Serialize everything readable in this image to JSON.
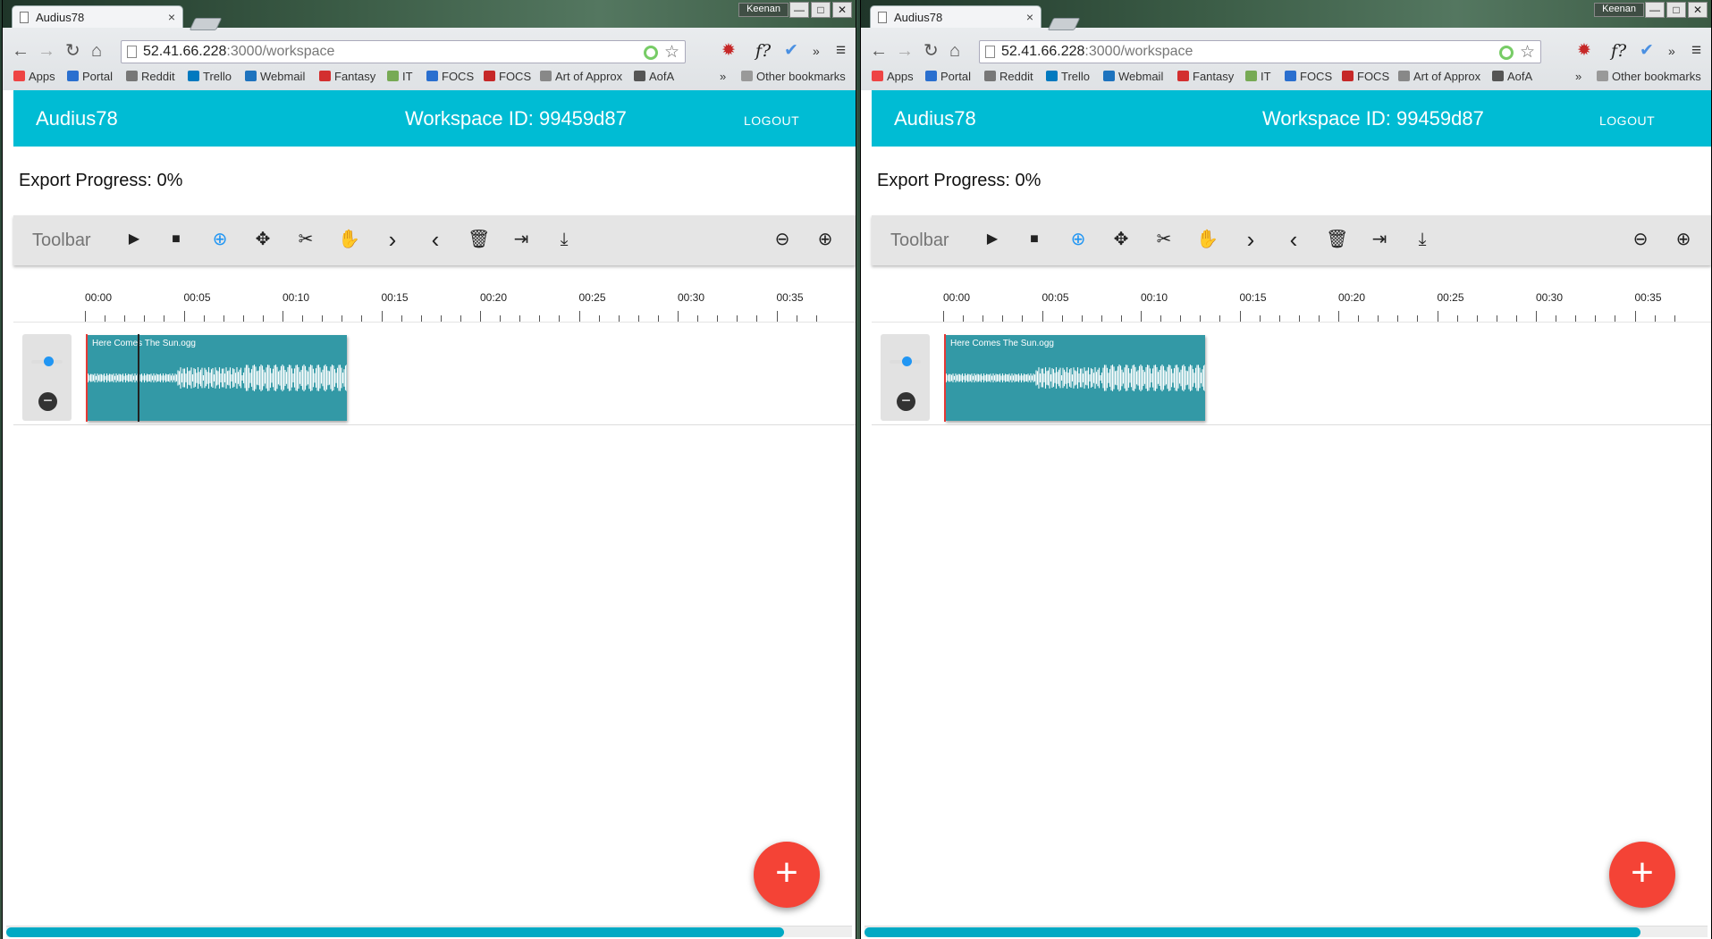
{
  "browser": {
    "tab_title": "Audius78",
    "tab_close": "×",
    "user_name": "Keenan",
    "win_minimize": "—",
    "win_maximize": "□",
    "win_close": "✕",
    "back": "←",
    "forward": "→",
    "reload": "↻",
    "home": "⌂",
    "url_host": "52.41.66.228",
    "url_path": ":3000/workspace",
    "ext_fx": "f?",
    "ext_more": "»",
    "menu": "≡",
    "bookmarks": [
      "Apps",
      "Portal",
      "Reddit",
      "Trello",
      "Webmail",
      "Fantasy",
      "IT",
      "FOCS",
      "FOCS",
      "Art of Approx",
      "AofA"
    ],
    "bookmarks_overflow": "»",
    "other_bookmarks": "Other bookmarks"
  },
  "app": {
    "name": "Audius78",
    "workspace_label": "Workspace ID: 99459d87",
    "logout": "LOGOUT",
    "export_progress": "Export Progress: 0%",
    "toolbar_label": "Toolbar",
    "add_button": "+",
    "remove_button": "−"
  },
  "timeline": {
    "labels": [
      "00:00",
      "00:05",
      "00:10",
      "00:15",
      "00:20",
      "00:25",
      "00:30",
      "00:35"
    ]
  },
  "clip": {
    "name": "Here Comes The Sun.ogg"
  },
  "colors": {
    "header": "#00bcd4",
    "clip": "#3399a6",
    "fab": "#f44336",
    "playhead": "#e53935"
  },
  "icons": [
    "play-icon",
    "stop-icon",
    "crosshair-icon",
    "move-icon",
    "scissors-icon",
    "hand-icon",
    "chevron-right-icon",
    "chevron-left-icon",
    "trash-icon",
    "merge-icon",
    "download-icon",
    "zoom-out-icon",
    "zoom-in-icon"
  ],
  "scrollbar_fraction": 0.92
}
